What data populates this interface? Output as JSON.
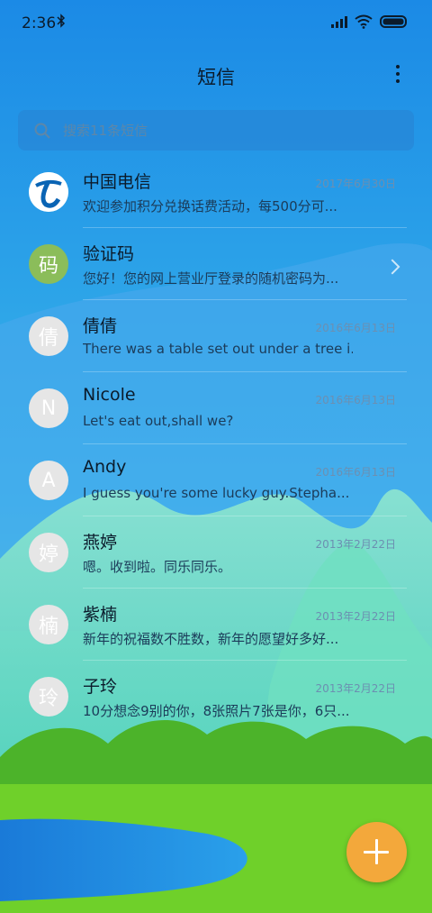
{
  "status_bar": {
    "time": "2:36"
  },
  "header": {
    "title": "短信"
  },
  "search": {
    "placeholder": "搜索11条短信"
  },
  "messages": [
    {
      "name": "中国电信",
      "date": "2017年6月30日",
      "preview": "欢迎参加积分兑换话费活动，每500分可...",
      "avatar": "telecom-logo"
    },
    {
      "name": "验证码",
      "date": "",
      "preview": "您好！您的网上营业厅登录的随机密码为...",
      "avatar_text": "码",
      "avatar_color": "#8bbd5a"
    },
    {
      "name": "倩倩",
      "date": "2016年6月13日",
      "preview": "There was a table set out under a tree i...",
      "avatar_text": "倩"
    },
    {
      "name": "Nicole",
      "date": "2016年6月13日",
      "preview": "Let's eat out,shall we?",
      "avatar_text": "N"
    },
    {
      "name": "Andy",
      "date": "2016年6月13日",
      "preview": "I guess you're some lucky guy.Stepha...",
      "avatar_text": "A"
    },
    {
      "name": "燕婷",
      "date": "2013年2月22日",
      "preview": "嗯。收到啦。同乐同乐。",
      "avatar_text": "婷"
    },
    {
      "name": "紫楠",
      "date": "2013年2月22日",
      "preview": "新年的祝福数不胜数，新年的愿望好多好...",
      "avatar_text": "楠"
    },
    {
      "name": "子玲",
      "date": "2013年2月22日",
      "preview": "10分想念9别的你，8张照片7张是你，6只...",
      "avatar_text": "玲"
    }
  ],
  "colors": {
    "fab": "#f3a83b",
    "sky_top": "#1e8fe6",
    "grass": "#6fd02a"
  }
}
